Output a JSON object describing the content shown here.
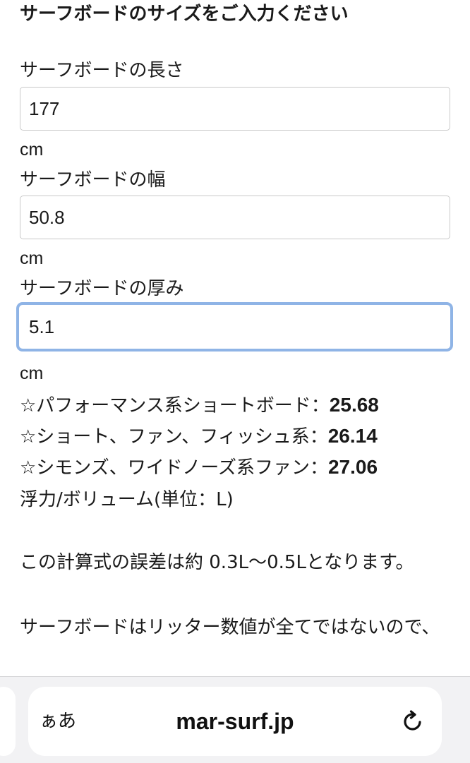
{
  "form": {
    "title": "サーフボードのサイズをご入力ください",
    "length_label": "サーフボードの長さ",
    "length_value": "177",
    "length_unit": "cm",
    "width_label": "サーフボードの幅",
    "width_value": "50.8",
    "width_unit": "cm",
    "thickness_label": "サーフボードの厚み",
    "thickness_value": "5.1",
    "thickness_unit": "cm"
  },
  "results": [
    {
      "label": "☆パフォーマンス系ショートボード：",
      "value": "25.68"
    },
    {
      "label": "☆ショート、ファン、フィッシュ系：",
      "value": "26.14"
    },
    {
      "label": "☆シモンズ、ワイドノーズ系ファン：",
      "value": "27.06"
    }
  ],
  "volume_unit_label": "浮力/ボリューム(単位：L)",
  "notes": {
    "error_note": "この計算式の誤差は約 0.3L〜0.5Lとなります。",
    "liter_note": "サーフボードはリッター数値が全てではないので、"
  },
  "browser": {
    "text_size_label": "ぁあ",
    "url": "mar-surf.jp",
    "reload_icon": "reload-icon"
  }
}
